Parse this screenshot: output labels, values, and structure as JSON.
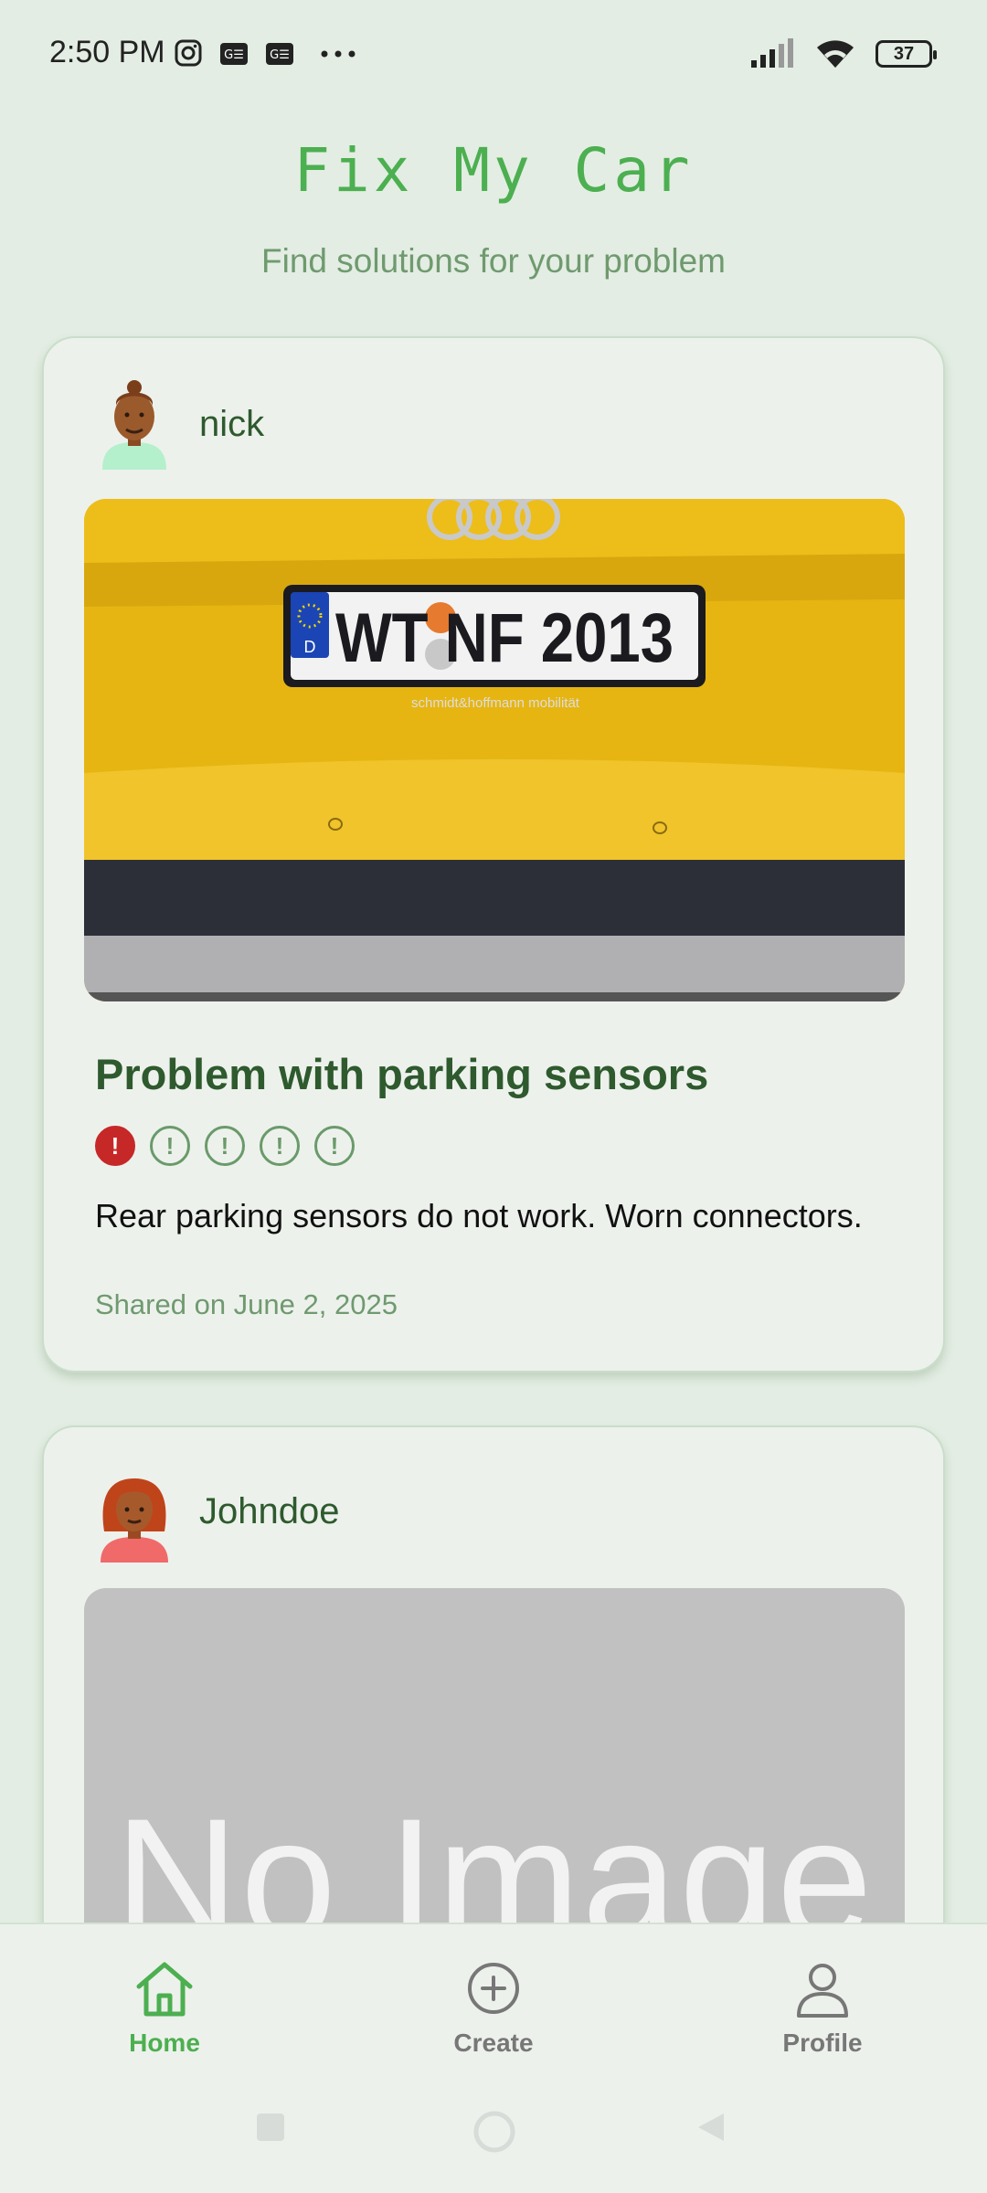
{
  "status_bar": {
    "time": "2:50 PM",
    "battery": "37",
    "icons": [
      "instagram-icon",
      "gallery-icon",
      "gallery-icon",
      "more-dots-icon",
      "signal-icon",
      "wifi-icon",
      "battery-icon"
    ]
  },
  "header": {
    "title": "Fix My Car",
    "subtitle": "Find solutions for your problem"
  },
  "posts": [
    {
      "username": "nick",
      "image": {
        "plate_text": "WT NF 2013",
        "country": "D",
        "dealer_text": "schmidt&hoffmann mobilität"
      },
      "title": "Problem with parking sensors",
      "severity": 1,
      "severity_max": 5,
      "description": "Rear parking sensors do not work. Worn connectors.",
      "date": "Shared on June 2, 2025"
    },
    {
      "username": "Johndoe",
      "image": {
        "placeholder_text": "No Image"
      }
    }
  ],
  "colors": {
    "accent": "#4caf50",
    "title_green": "#2e5a2e",
    "severity_active": "#c62828",
    "background": "#e3ede3"
  },
  "nav": {
    "items": [
      {
        "label": "Home",
        "icon": "home-icon",
        "active": true
      },
      {
        "label": "Create",
        "icon": "plus-circle-icon",
        "active": false
      },
      {
        "label": "Profile",
        "icon": "person-icon",
        "active": false
      }
    ]
  }
}
